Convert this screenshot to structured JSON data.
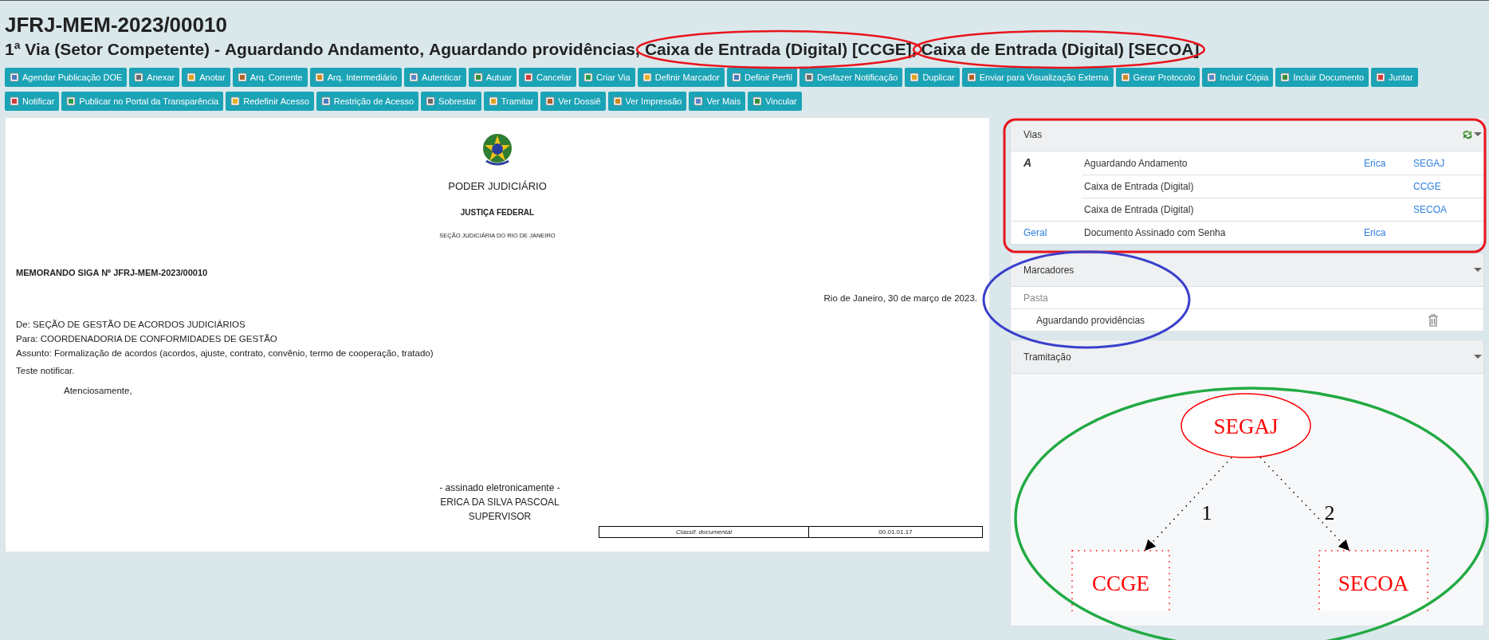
{
  "document_code": "JFRJ-MEM-2023/00010",
  "status_line": {
    "via": "1ª Via (Setor Competente) -",
    "statuses": [
      "Aguardando Andamento,",
      "Aguardando providências,",
      "Caixa de Entrada (Digital) [CCGE],",
      "Caixa de Entrada (Digital) [SECOA]"
    ]
  },
  "toolbar_rows": [
    [
      "Agendar Publicação DOE",
      "Anexar",
      "Anotar",
      "Arq. Corrente",
      "Arq. Intermediário",
      "Autenticar",
      "Autuar",
      "Cancelar",
      "Criar Via",
      "Definir Marcador",
      "Definir Perfil",
      "Desfazer Notificação",
      "Duplicar",
      "Enviar para Visualização Externa",
      "Gerar Protocolo",
      "Incluir Cópia",
      "Incluir Documento",
      "Juntar"
    ],
    [
      "Notificar",
      "Publicar no Portal da Transparência",
      "Redefinir Acesso",
      "Restrição de Acesso",
      "Sobrestar",
      "Tramitar",
      "Ver Dossiê",
      "Ver Impressão",
      "Ver Mais",
      "Vincular"
    ]
  ],
  "memo": {
    "header": [
      "PODER JUDICIÁRIO",
      "JUSTIÇA FEDERAL",
      "SEÇÃO JUDICIÁRIA DO RIO DE JANEIRO"
    ],
    "title": "MEMORANDO SIGA Nº JFRJ-MEM-2023/00010",
    "date": "Rio de Janeiro, 30 de março de 2023.",
    "lines": [
      "De: SEÇÃO DE GESTÃO DE ACORDOS JUDICIÁRIOS",
      "Para: COORDENADORIA DE CONFORMIDADES DE GESTÃO",
      "Assunto: Formalização de acordos (acordos, ajuste, contrato, convênio, termo de cooperação, tratado)"
    ],
    "body": "Teste notificar.",
    "closing": "Atenciosamente,",
    "signature": [
      "- assinado eletronicamente -",
      "ERICA DA SILVA PASCOAL",
      "SUPERVISOR"
    ],
    "classification": {
      "label": "Classif. documental",
      "value": "00.01.01.17"
    }
  },
  "vias": {
    "title": "Vias",
    "rows": [
      {
        "via": "A",
        "kind": "letter",
        "event": "Aguardando Andamento",
        "person": "Erica",
        "unit": "SEGAJ"
      },
      {
        "event": "Caixa de Entrada (Digital)",
        "unit": "CCGE"
      },
      {
        "event": "Caixa de Entrada (Digital)",
        "unit": "SECOA"
      },
      {
        "via": "Geral",
        "kind": "link",
        "event": "Documento Assinado com Senha",
        "person": "Erica"
      }
    ]
  },
  "marcadores": {
    "title": "Marcadores",
    "group": "Pasta",
    "items": [
      "Aguardando providências"
    ]
  },
  "tramitacao": {
    "title": "Tramitação",
    "nodes": [
      {
        "label": "SEGAJ",
        "kind": "ellipse"
      },
      {
        "label": "CCGE",
        "kind": "box"
      },
      {
        "label": "SECOA",
        "kind": "box"
      }
    ],
    "edges": [
      {
        "label": "1"
      },
      {
        "label": "2"
      }
    ]
  }
}
